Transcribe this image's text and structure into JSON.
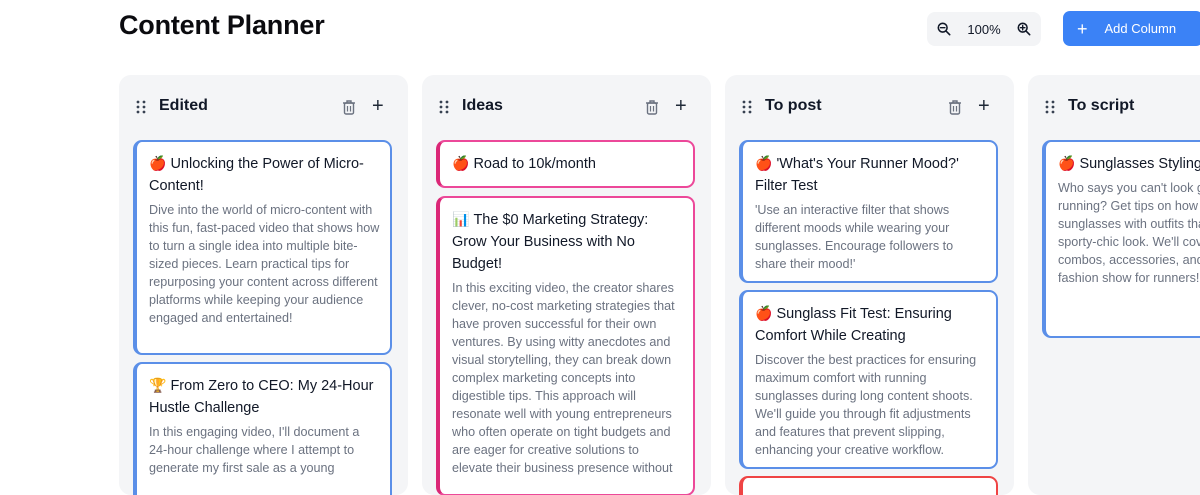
{
  "header": {
    "title": "Content Planner",
    "zoom_level": "100%",
    "add_column_label": "Add Column"
  },
  "colors": {
    "accent": "#3b82f6",
    "card_blue": "#5b8fe8",
    "card_pink": "#ec4899",
    "column_bg": "#f4f5f7"
  },
  "columns": [
    {
      "title": "Edited",
      "cards": [
        {
          "icon": "🍎",
          "title": "Unlocking the Power of Micro-Content!",
          "description": "Dive into the world of micro-content with this fun, fast-paced video that shows how to turn a single idea into multiple bite-sized pieces. Learn practical tips for repurposing your content across different platforms while keeping your audience engaged and entertained!",
          "accent": "blue"
        },
        {
          "icon": "🏆",
          "title": "From Zero to CEO: My 24-Hour Hustle Challenge",
          "description": "In this engaging video, I'll document a 24-hour challenge where I attempt to generate my first sale as a young",
          "accent": "blue"
        }
      ]
    },
    {
      "title": "Ideas",
      "cards": [
        {
          "icon": "🍎",
          "title": "Road to 10k/month",
          "description": "",
          "accent": "pink"
        },
        {
          "icon": "📊",
          "title": "The $0 Marketing Strategy: Grow Your Business with No Budget!",
          "description": "In this exciting video, the creator shares clever, no-cost marketing strategies that have proven successful for their own ventures. By using witty anecdotes and visual storytelling, they can break down complex marketing concepts into digestible tips. This approach will resonate well with young entrepreneurs who often operate on tight budgets and are eager for creative solutions to elevate their business presence without",
          "accent": "pink"
        }
      ]
    },
    {
      "title": "To post",
      "cards": [
        {
          "icon": "🍎",
          "title": "'What's Your Runner Mood?' Filter Test",
          "description": "'Use an interactive filter that shows different moods while wearing your sunglasses. Encourage followers to share their mood!'",
          "accent": "blue"
        },
        {
          "icon": "🍎",
          "title": "Sunglass Fit Test: Ensuring Comfort While Creating",
          "description": "Discover the best practices for ensuring maximum comfort with running sunglasses during long content shoots. We'll guide you through fit adjustments and features that prevent slipping, enhancing your creative workflow.",
          "accent": "blue"
        }
      ]
    },
    {
      "title": "To script",
      "cards": [
        {
          "icon": "🍎",
          "title": "Sunglasses Styling: Look Good While You",
          "description": "Who says you can't look good while running? Get tips on how to style running sunglasses with outfits that perfect sporty-chic look. We'll cover color combos, accessories, and even a mini fashion show for runners!",
          "accent": "blue"
        }
      ]
    }
  ]
}
